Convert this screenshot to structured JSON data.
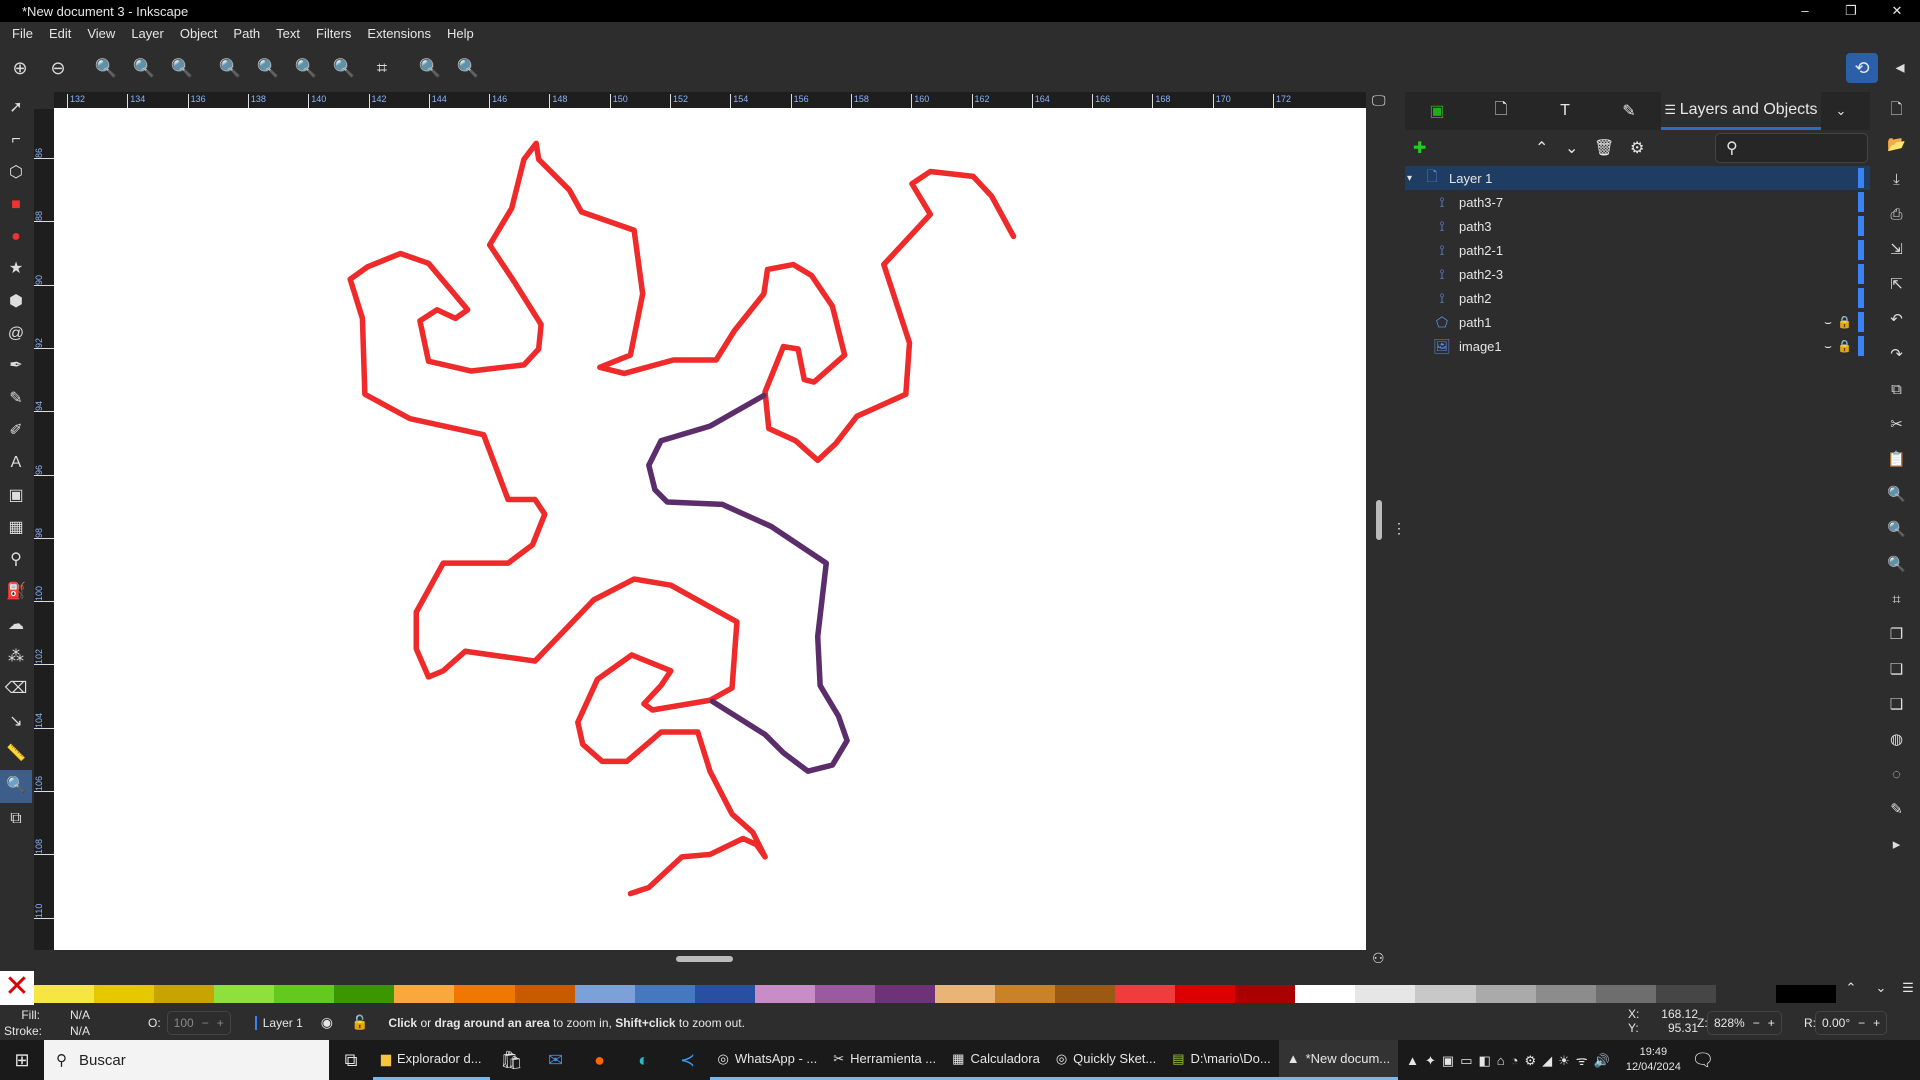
{
  "window": {
    "title": "*New document 3 - Inkscape",
    "controls": [
      "–",
      "❐",
      "✕"
    ]
  },
  "menu": [
    "File",
    "Edit",
    "View",
    "Layer",
    "Object",
    "Path",
    "Text",
    "Filters",
    "Extensions",
    "Help"
  ],
  "command_bar_icons": [
    "zoom-in",
    "zoom-out",
    "zoom-1-1",
    "zoom-1-2",
    "zoom-2-1",
    "zoom-selection",
    "zoom-drawing",
    "zoom-page",
    "zoom-page-width",
    "zoom-center",
    "zoom-previous",
    "zoom-next"
  ],
  "toolbox": [
    "selector",
    "node",
    "shape-builder",
    "rectangle",
    "ellipse",
    "star",
    "3d-box",
    "spiral",
    "pen",
    "pencil",
    "calligraphy",
    "text",
    "gradient",
    "mesh",
    "dropper",
    "paint-bucket",
    "tweak",
    "spray",
    "eraser",
    "connector",
    "measure",
    "zoom",
    "pages"
  ],
  "ruler": {
    "top": [
      "132",
      "134",
      "136",
      "138",
      "140",
      "142",
      "144",
      "146",
      "148",
      "150",
      "152",
      "154",
      "156",
      "158",
      "160",
      "162",
      "164",
      "166",
      "168",
      "170",
      "172"
    ],
    "left": [
      "86",
      "88",
      "90",
      "92",
      "94",
      "96",
      "98",
      "100",
      "102",
      "104",
      "106",
      "108",
      "110"
    ]
  },
  "colors": {
    "red_path": "#ee2a2a",
    "purple_path": "#5b2d6b",
    "selection": "#1f3d63",
    "accent": "#3b82f6"
  },
  "dock": {
    "active_tab": "Layers and Objects",
    "close": "✕",
    "layers": [
      {
        "name": "Layer 1",
        "type": "layer"
      },
      {
        "name": "path3-7",
        "type": "path"
      },
      {
        "name": "path3",
        "type": "path"
      },
      {
        "name": "path2-1",
        "type": "path"
      },
      {
        "name": "path2-3",
        "type": "path"
      },
      {
        "name": "path2",
        "type": "path"
      },
      {
        "name": "path1",
        "type": "polygon",
        "hidden": true,
        "locked": true
      },
      {
        "name": "image1",
        "type": "image",
        "hidden": true,
        "locked": true
      }
    ]
  },
  "palette": [
    "#f5e642",
    "#e6c800",
    "#c8a400",
    "#8ee03c",
    "#64c81e",
    "#3c9600",
    "#f8a83c",
    "#f07800",
    "#c85a00",
    "#7ca0d8",
    "#4678be",
    "#2850a0",
    "#c88cc8",
    "#9b5aa0",
    "#6e3278",
    "#e8b478",
    "#c88228",
    "#9b5a14",
    "#f03c3c",
    "#dc0000",
    "#aa0000",
    "#ffffff",
    "#e6e6e6",
    "#c8c8c8",
    "#aaaaaa",
    "#8c8c8c",
    "#6e6e6e",
    "#464646",
    "#2d2d2d",
    "#000000"
  ],
  "status": {
    "fill_label": "Fill:",
    "fill": "N/A",
    "stroke_label": "Stroke:",
    "stroke": "N/A",
    "opacity_label": "O:",
    "opacity": "100",
    "layer": "Layer 1",
    "message_parts": [
      "Click",
      " or ",
      "drag around an area",
      " to zoom in, ",
      "Shift+click",
      " to zoom out."
    ],
    "x_label": "X:",
    "x": "168.12",
    "y_label": "Y:",
    "y": "95.31",
    "zoom_label": "Z:",
    "zoom": "828%",
    "rotation_label": "R:",
    "rotation": "0.00°"
  },
  "taskbar": {
    "search": "Buscar",
    "apps": [
      "Explorador d...",
      "WhatsApp - ...",
      "Herramienta ...",
      "Calculadora",
      "Quickly Sket...",
      "D:\\mario\\Do...",
      "*New docum..."
    ],
    "time": "19:49",
    "date": "12/04/2024"
  }
}
